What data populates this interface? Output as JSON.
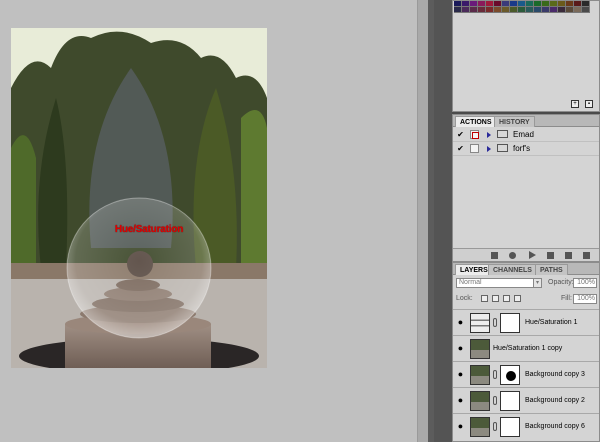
{
  "document": {
    "image_caption": "Hue/Saturation"
  },
  "swatches": {
    "row1": [
      "#1a1a5a",
      "#3a1a6a",
      "#6a1a7a",
      "#8a1a5a",
      "#a01a3a",
      "#6a0a2a",
      "#3a3a7a",
      "#1a3a8a",
      "#1a5a8a",
      "#1a6a5a",
      "#1a6a2a",
      "#3a6a1a",
      "#5a6a1a",
      "#6a5a1a",
      "#6a3a1a",
      "#5a1a1a",
      "#2a2a2a"
    ],
    "row2": [
      "#2a2a4a",
      "#4a2a5a",
      "#5a2a4a",
      "#6a2a3a",
      "#7a2a2a",
      "#7a4a2a",
      "#6a5a2a",
      "#4a5a2a",
      "#2a5a3a",
      "#2a5a5a",
      "#2a4a6a",
      "#3a3a6a",
      "#4a2a6a",
      "#3a2a3a",
      "#5a4a3a",
      "#7a6a5a",
      "#4a4a4a"
    ]
  },
  "actions_panel": {
    "tabs": [
      "ACTIONS",
      "HISTORY"
    ],
    "rows": [
      {
        "check": "✔",
        "dialog_on": true,
        "label": "Emad"
      },
      {
        "check": "✔",
        "dialog_on": false,
        "label": "forf's"
      }
    ]
  },
  "layers_panel": {
    "tabs": [
      "LAYERS",
      "CHANNELS",
      "PATHS"
    ],
    "blend_mode": "Normal",
    "opacity_label": "Opacity:",
    "opacity_value": "100%",
    "lock_label": "Lock:",
    "fill_label": "Fill:",
    "fill_value": "100%",
    "layers": [
      {
        "name": "Hue/Saturation 1",
        "thumb": "adjust",
        "mask": "plain",
        "eye": "●"
      },
      {
        "name": "Hue/Saturation 1 copy",
        "thumb": "photo",
        "mask": "none",
        "eye": "●"
      },
      {
        "name": "Background copy 3",
        "thumb": "photo",
        "mask": "dot",
        "eye": "●"
      },
      {
        "name": "Background copy 2",
        "thumb": "photo",
        "mask": "plain",
        "eye": "●"
      },
      {
        "name": "Background copy 6",
        "thumb": "photo",
        "mask": "plain",
        "eye": "●"
      }
    ]
  },
  "icons": {
    "eye": "eye-icon",
    "folder": "folder-icon",
    "chain": "link-icon",
    "new": "new-item-icon",
    "trash": "trash-icon"
  }
}
